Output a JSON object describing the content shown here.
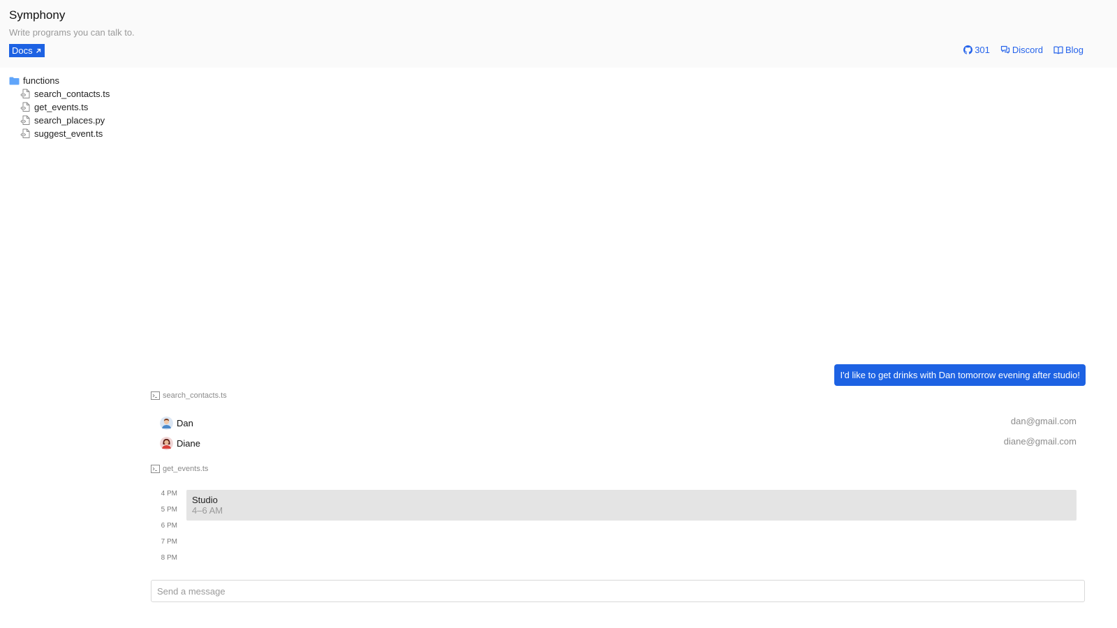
{
  "header": {
    "title": "Symphony",
    "subtitle": "Write programs you can talk to.",
    "docs_label": "Docs",
    "links": {
      "github_count": "301",
      "discord": "Discord",
      "blog": "Blog"
    },
    "link_color": "#2563eb",
    "accent_color": "#1d62e3"
  },
  "tree": {
    "folder": "functions",
    "files": [
      "search_contacts.ts",
      "get_events.ts",
      "search_places.py",
      "suggest_event.ts"
    ]
  },
  "chat": {
    "user_message": "I'd like to get drinks with Dan tomorrow evening after studio!",
    "tool_calls": [
      {
        "name": "search_contacts.ts",
        "contacts": [
          {
            "name": "Dan",
            "email": "dan@gmail.com"
          },
          {
            "name": "Diane",
            "email": "diane@gmail.com"
          }
        ]
      },
      {
        "name": "get_events.ts",
        "hours": [
          "4 PM",
          "5 PM",
          "6 PM",
          "7 PM",
          "8 PM"
        ],
        "events": [
          {
            "title": "Studio",
            "time": "4–6 AM"
          }
        ]
      }
    ]
  },
  "composer": {
    "placeholder": "Send a message"
  },
  "icons": {
    "docs": "external-link-icon",
    "github": "github-icon",
    "discord": "chat-bubbles-icon",
    "blog": "book-icon",
    "folder": "folder-icon",
    "file": "code-file-icon",
    "tool": "terminal-icon"
  }
}
